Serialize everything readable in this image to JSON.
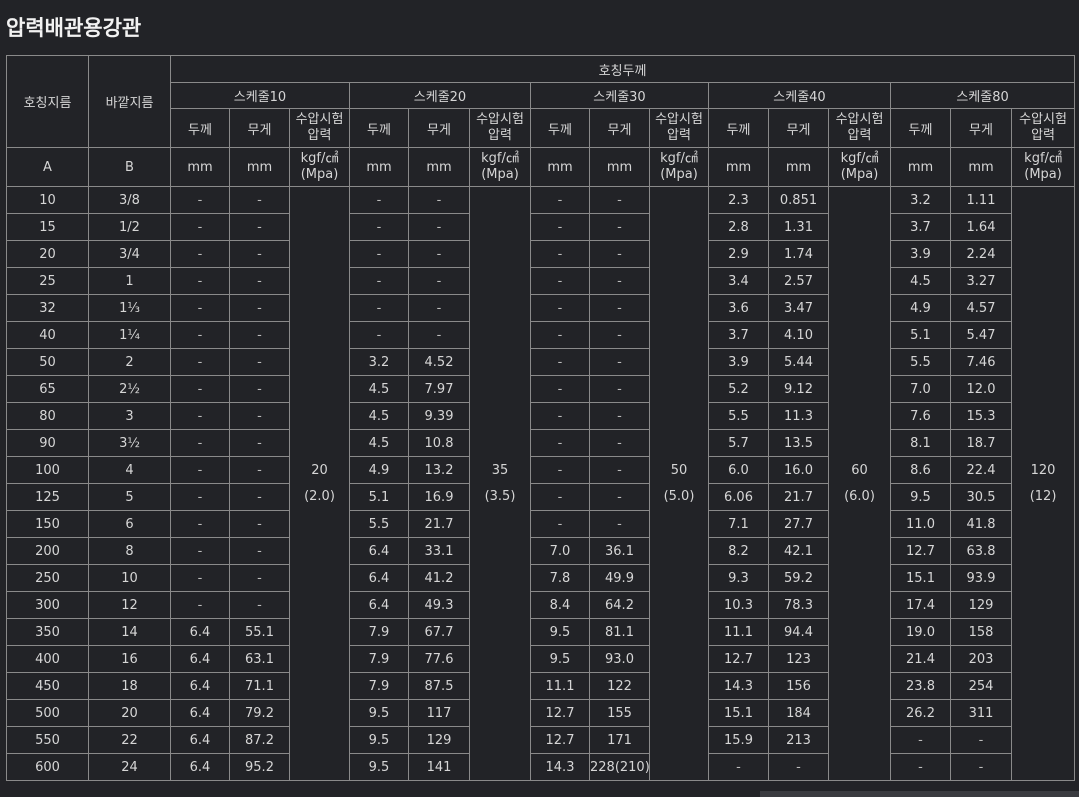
{
  "title": "압력배관용강관",
  "header": {
    "nominal_size": "호칭지름",
    "outer_diameter": "바깥지름",
    "nominal_thickness": "호칭두께",
    "schedules": [
      "스케줄10",
      "스케줄20",
      "스케줄30",
      "스케줄40",
      "스케줄80"
    ],
    "thickness": "두께",
    "weight": "무게",
    "test_pressure": "수압시험 압력",
    "unit_a": "A",
    "unit_b": "B",
    "unit_mm": "mm",
    "unit_pressure": "kgf/㎠ (Mpa)"
  },
  "pressures": [
    {
      "value": "20",
      "mpa": "(2.0)"
    },
    {
      "value": "35",
      "mpa": "(3.5)"
    },
    {
      "value": "50",
      "mpa": "(5.0)"
    },
    {
      "value": "60",
      "mpa": "(6.0)"
    },
    {
      "value": "120",
      "mpa": "(12)"
    }
  ],
  "rows": [
    [
      "10",
      "3/8",
      "-",
      "-",
      "-",
      "-",
      "-",
      "-",
      "2.3",
      "0.851",
      "3.2",
      "1.11"
    ],
    [
      "15",
      "1/2",
      "-",
      "-",
      "-",
      "-",
      "-",
      "-",
      "2.8",
      "1.31",
      "3.7",
      "1.64"
    ],
    [
      "20",
      "3/4",
      "-",
      "-",
      "-",
      "-",
      "-",
      "-",
      "2.9",
      "1.74",
      "3.9",
      "2.24"
    ],
    [
      "25",
      "1",
      "-",
      "-",
      "-",
      "-",
      "-",
      "-",
      "3.4",
      "2.57",
      "4.5",
      "3.27"
    ],
    [
      "32",
      "1⅓",
      "-",
      "-",
      "-",
      "-",
      "-",
      "-",
      "3.6",
      "3.47",
      "4.9",
      "4.57"
    ],
    [
      "40",
      "1¼",
      "-",
      "-",
      "-",
      "-",
      "-",
      "-",
      "3.7",
      "4.10",
      "5.1",
      "5.47"
    ],
    [
      "50",
      "2",
      "-",
      "-",
      "3.2",
      "4.52",
      "-",
      "-",
      "3.9",
      "5.44",
      "5.5",
      "7.46"
    ],
    [
      "65",
      "2½",
      "-",
      "-",
      "4.5",
      "7.97",
      "-",
      "-",
      "5.2",
      "9.12",
      "7.0",
      "12.0"
    ],
    [
      "80",
      "3",
      "-",
      "-",
      "4.5",
      "9.39",
      "-",
      "-",
      "5.5",
      "11.3",
      "7.6",
      "15.3"
    ],
    [
      "90",
      "3½",
      "-",
      "-",
      "4.5",
      "10.8",
      "-",
      "-",
      "5.7",
      "13.5",
      "8.1",
      "18.7"
    ],
    [
      "100",
      "4",
      "-",
      "-",
      "4.9",
      "13.2",
      "-",
      "-",
      "6.0",
      "16.0",
      "8.6",
      "22.4"
    ],
    [
      "125",
      "5",
      "-",
      "-",
      "5.1",
      "16.9",
      "-",
      "-",
      "6.06",
      "21.7",
      "9.5",
      "30.5"
    ],
    [
      "150",
      "6",
      "-",
      "-",
      "5.5",
      "21.7",
      "-",
      "-",
      "7.1",
      "27.7",
      "11.0",
      "41.8"
    ],
    [
      "200",
      "8",
      "-",
      "-",
      "6.4",
      "33.1",
      "7.0",
      "36.1",
      "8.2",
      "42.1",
      "12.7",
      "63.8"
    ],
    [
      "250",
      "10",
      "-",
      "-",
      "6.4",
      "41.2",
      "7.8",
      "49.9",
      "9.3",
      "59.2",
      "15.1",
      "93.9"
    ],
    [
      "300",
      "12",
      "-",
      "-",
      "6.4",
      "49.3",
      "8.4",
      "64.2",
      "10.3",
      "78.3",
      "17.4",
      "129"
    ],
    [
      "350",
      "14",
      "6.4",
      "55.1",
      "7.9",
      "67.7",
      "9.5",
      "81.1",
      "11.1",
      "94.4",
      "19.0",
      "158"
    ],
    [
      "400",
      "16",
      "6.4",
      "63.1",
      "7.9",
      "77.6",
      "9.5",
      "93.0",
      "12.7",
      "123",
      "21.4",
      "203"
    ],
    [
      "450",
      "18",
      "6.4",
      "71.1",
      "7.9",
      "87.5",
      "11.1",
      "122",
      "14.3",
      "156",
      "23.8",
      "254"
    ],
    [
      "500",
      "20",
      "6.4",
      "79.2",
      "9.5",
      "117",
      "12.7",
      "155",
      "15.1",
      "184",
      "26.2",
      "311"
    ],
    [
      "550",
      "22",
      "6.4",
      "87.2",
      "9.5",
      "129",
      "12.7",
      "171",
      "15.9",
      "213",
      "-",
      "-"
    ],
    [
      "600",
      "24",
      "6.4",
      "95.2",
      "9.5",
      "141",
      "14.3",
      "228(210)",
      "-",
      "-",
      "-",
      "-"
    ]
  ]
}
